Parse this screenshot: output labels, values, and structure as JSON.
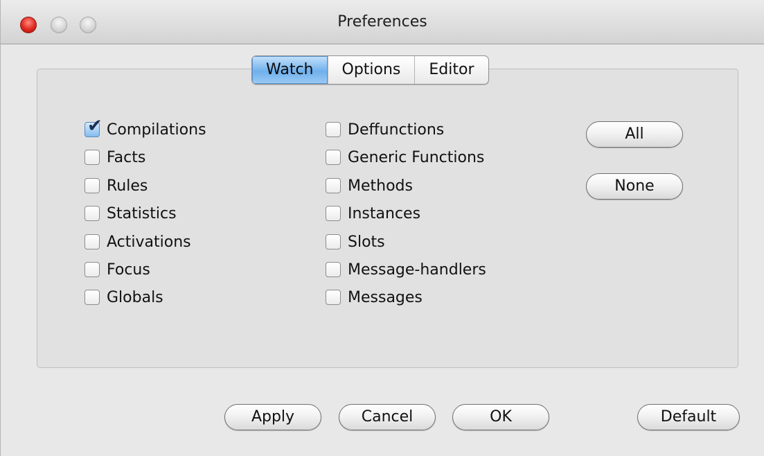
{
  "window": {
    "title": "Preferences"
  },
  "tabs": [
    {
      "label": "Watch",
      "selected": true
    },
    {
      "label": "Options",
      "selected": false
    },
    {
      "label": "Editor",
      "selected": false
    }
  ],
  "checkboxes_left": [
    {
      "label": "Compilations",
      "checked": true
    },
    {
      "label": "Facts",
      "checked": false
    },
    {
      "label": "Rules",
      "checked": false
    },
    {
      "label": "Statistics",
      "checked": false
    },
    {
      "label": "Activations",
      "checked": false
    },
    {
      "label": "Focus",
      "checked": false
    },
    {
      "label": "Globals",
      "checked": false
    }
  ],
  "checkboxes_right": [
    {
      "label": "Deffunctions",
      "checked": false
    },
    {
      "label": "Generic Functions",
      "checked": false
    },
    {
      "label": "Methods",
      "checked": false
    },
    {
      "label": "Instances",
      "checked": false
    },
    {
      "label": "Slots",
      "checked": false
    },
    {
      "label": "Message-handlers",
      "checked": false
    },
    {
      "label": "Messages",
      "checked": false
    }
  ],
  "side_buttons": {
    "all": "All",
    "none": "None"
  },
  "footer": {
    "apply": "Apply",
    "cancel": "Cancel",
    "ok": "OK",
    "default": "Default"
  },
  "colors": {
    "tab_selected": "#6fb0ec",
    "close_button": "#e0281f"
  }
}
